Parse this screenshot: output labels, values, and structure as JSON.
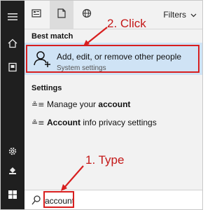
{
  "tabs": [
    {
      "icon": "apps-icon"
    },
    {
      "icon": "document-icon"
    },
    {
      "icon": "web-globe-icon"
    }
  ],
  "filters": {
    "label": "Filters"
  },
  "best_match": {
    "heading": "Best match",
    "title": "Add, edit, or remove other people",
    "subtitle": "System settings",
    "icon": "add-user-icon"
  },
  "settings": {
    "heading": "Settings",
    "items": [
      {
        "prefix": "Manage your ",
        "bold": "account",
        "suffix": "",
        "icon": "settings-list-icon"
      },
      {
        "prefix": "",
        "bold": "Account",
        "suffix": " info privacy settings",
        "icon": "settings-list-icon"
      }
    ]
  },
  "search": {
    "value": "account"
  },
  "annotations": {
    "click": "2. Click",
    "type": "1. Type",
    "color": "#d81f1f"
  },
  "rail_icons": [
    "menu-icon",
    "home-icon",
    "contacts-icon",
    "settings-gear-icon",
    "user-icon",
    "windows-start-icon"
  ]
}
